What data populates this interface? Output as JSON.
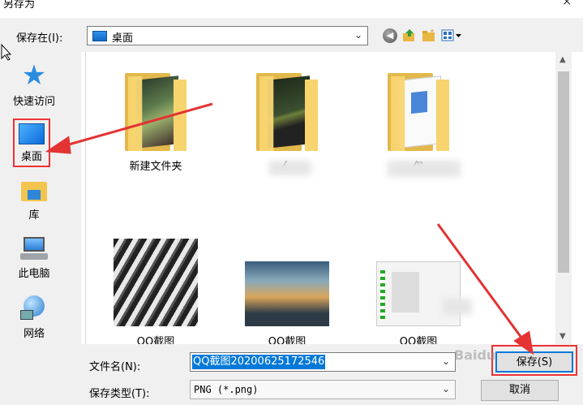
{
  "dialog": {
    "title": "另存为",
    "close_glyph": "×"
  },
  "toolbar": {
    "save_in_label": "保存在(I):",
    "save_in_value": "桌面"
  },
  "places": [
    {
      "id": "quick",
      "label": "快速访问",
      "icon": "star-icon"
    },
    {
      "id": "desktop",
      "label": "桌面",
      "icon": "desktop-icon"
    },
    {
      "id": "library",
      "label": "库",
      "icon": "library-icon"
    },
    {
      "id": "pc",
      "label": "此电脑",
      "icon": "computer-icon"
    },
    {
      "id": "network",
      "label": "网络",
      "icon": "network-icon"
    }
  ],
  "files": [
    {
      "name": "新建文件夹",
      "type": "folder"
    },
    {
      "name": "亻",
      "type": "folder"
    },
    {
      "name": "仅",
      "type": "folder"
    },
    {
      "name": "QQ截图",
      "type": "image"
    },
    {
      "name": "QQ截图",
      "type": "image"
    },
    {
      "name": "QQ截图",
      "type": "image"
    }
  ],
  "bottom": {
    "filename_label": "文件名(N):",
    "filename_value": "QQ截图20200625172546",
    "filetype_label": "保存类型(T):",
    "filetype_value": "PNG (*.png)",
    "save_button": "保存(S)",
    "cancel_button": "取消"
  },
  "watermark": "Baidu",
  "colors": {
    "accent": "#0078d7",
    "annotation": "#e33333"
  }
}
